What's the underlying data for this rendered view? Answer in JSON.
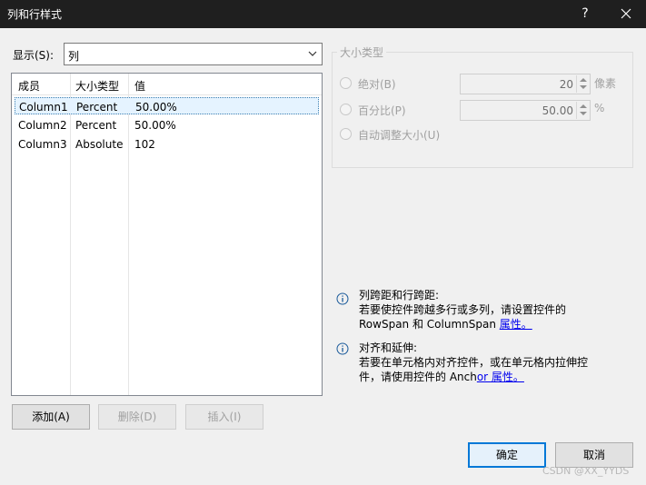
{
  "window": {
    "title": "列和行样式",
    "help_label": "?"
  },
  "show": {
    "label": "显示(S):",
    "selected": "列"
  },
  "member_list": {
    "headers": [
      "成员",
      "大小类型",
      "值"
    ],
    "rows": [
      {
        "name": "Column1",
        "size_type": "Percent",
        "value": "50.00%",
        "selected": true
      },
      {
        "name": "Column2",
        "size_type": "Percent",
        "value": "50.00%",
        "selected": false
      },
      {
        "name": "Column3",
        "size_type": "Absolute",
        "value": "102",
        "selected": false
      }
    ]
  },
  "buttons": {
    "add": "添加(A)",
    "delete": "删除(D)",
    "insert": "插入(I)",
    "ok": "确定",
    "cancel": "取消"
  },
  "size_type": {
    "legend": "大小类型",
    "absolute_label": "绝对(B)",
    "absolute_value": "20",
    "absolute_unit": "像素",
    "percent_label": "百分比(P)",
    "percent_value": "50.00",
    "percent_unit": "%",
    "auto_label": "自动调整大小(U)"
  },
  "notes": {
    "span_title": "列跨距和行跨距:",
    "span_line1": "若要使控件跨越多行或多列，请设置控件的",
    "span_line2": "RowSpan 和 ColumnSpan ",
    "span_link": "属性。",
    "align_title": "对齐和延伸:",
    "align_line1": "若要在单元格内对齐控件，或在单元格内拉伸控",
    "align_line2": "件，请使用控件的 Anch",
    "align_link": "or 属性。"
  },
  "watermark": "CSDN @XX_YYDS"
}
